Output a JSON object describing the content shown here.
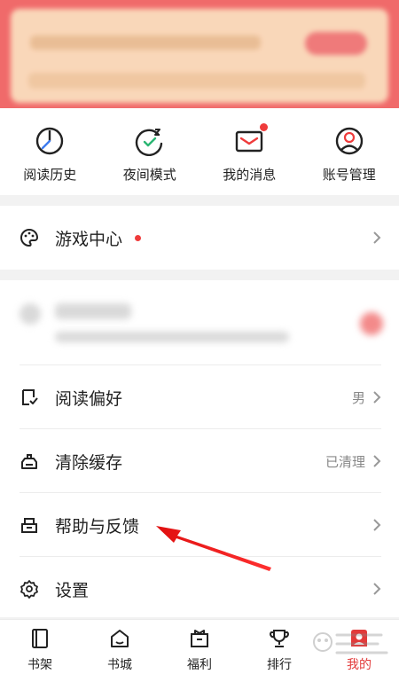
{
  "quick_actions": [
    {
      "icon": "reading-history-icon",
      "label": "阅读历史"
    },
    {
      "icon": "night-mode-icon",
      "label": "夜间模式"
    },
    {
      "icon": "message-icon",
      "label": "我的消息"
    },
    {
      "icon": "account-icon",
      "label": "账号管理"
    }
  ],
  "game_center": {
    "label": "游戏中心",
    "icon": "game-palette-icon"
  },
  "menu": [
    {
      "label": "阅读偏好",
      "value": "男",
      "icon": "reading-preference-icon"
    },
    {
      "label": "清除缓存",
      "value": "已清理",
      "icon": "clear-cache-icon"
    },
    {
      "label": "帮助与反馈",
      "value": "",
      "icon": "help-feedback-icon"
    },
    {
      "label": "设置",
      "value": "",
      "icon": "gear-icon"
    }
  ],
  "tabs": [
    {
      "label": "书架",
      "icon": "bookshelf-icon"
    },
    {
      "label": "书城",
      "icon": "bookstore-icon"
    },
    {
      "label": "福利",
      "icon": "welfare-icon"
    },
    {
      "label": "排行",
      "icon": "trophy-icon"
    },
    {
      "label": "我的",
      "icon": "profile-icon",
      "active": true
    }
  ],
  "colors": {
    "accent": "#e23a3a",
    "banner": "#f06a6a",
    "notification_dot": "#ef3b3b"
  }
}
